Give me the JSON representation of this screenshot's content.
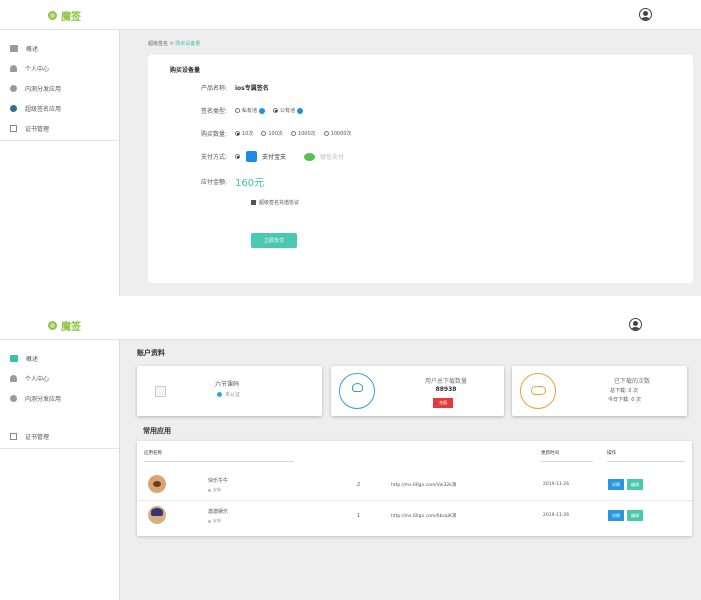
{
  "shot1": {
    "topbar": {
      "logo_text": "魔签"
    },
    "sidebar": {
      "items": [
        {
          "label": "概述"
        },
        {
          "label": "个人中心"
        },
        {
          "label": "内测分发应用"
        },
        {
          "label": "超级签名应用"
        },
        {
          "label": "证书管理"
        }
      ]
    },
    "breadcrumb": {
      "parent": "超级签名",
      "separator": " > ",
      "current": "购买设备量"
    },
    "purchase": {
      "title": "购买设备量",
      "product_label": "产品名称:",
      "product_value": "ios专属签名",
      "sign_type_label": "签名类型:",
      "sign_type_options": [
        "私有池",
        "公有池"
      ],
      "quantity_label": "购买数量:",
      "quantity_options": [
        "10次",
        "100次",
        "1000次",
        "10000次"
      ],
      "pay_method_label": "支付方式:",
      "pay_alipay": "支付宝支",
      "pay_wechat": "微信支付",
      "amount_label": "应付金额:",
      "amount_value": "160元",
      "agree_text": "超级签名充值协议",
      "pay_button": "立即支付"
    }
  },
  "shot2": {
    "topbar": {
      "logo_text": "魔签"
    },
    "sidebar": {
      "items": [
        {
          "label": "概述"
        },
        {
          "label": "个人中心"
        },
        {
          "label": "内测分发应用"
        },
        {
          "label": "证书管理"
        }
      ]
    },
    "account": {
      "title": "账户资料",
      "profile_name": "六节课码",
      "profile_badge": "未认证",
      "downloads_label": "用户总下载数量",
      "downloads_value": "88938",
      "downloads_button": "充值",
      "remaining_label": "已下载的次数",
      "total_line": "总下载: 0 次",
      "today_line": "今日下载: 0 次"
    },
    "apps": {
      "title": "常用应用",
      "headers": [
        "应用名称",
        "更新时间",
        "操作"
      ],
      "rows": [
        {
          "name": "快乐牛牛",
          "platform": "安装",
          "count": "2",
          "url": "http://ms.60gx.com/Vai32k演",
          "date": "2019-11-26",
          "detail": "详情",
          "edit": "编辑"
        },
        {
          "name": "激激娱乐",
          "platform": "安装",
          "count": "1",
          "url": "http://ms.60gx.com/6bsqiK演",
          "date": "2019-11-26",
          "detail": "详情",
          "edit": "编辑"
        }
      ]
    }
  },
  "colors": {
    "brand": "#8cc63f",
    "accent": "#48c9b0",
    "danger": "#e23b3b",
    "info": "#2a97e0"
  },
  "icons": [
    "logo-icon",
    "user-avatar-icon",
    "monitor-icon",
    "user-icon",
    "globe-icon",
    "compass-icon",
    "certificate-icon",
    "help-icon",
    "alipay-icon",
    "wechat-icon",
    "person-icon",
    "cloud-download-icon"
  ]
}
